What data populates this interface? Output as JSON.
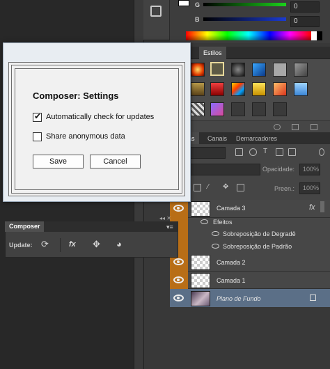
{
  "color_panel": {
    "g_label": "G",
    "b_label": "B",
    "g_value": "0",
    "b_value": "0"
  },
  "styles_panel": {
    "tabs": [
      "s",
      "Estilos"
    ]
  },
  "layers_panel": {
    "tabs": [
      "adas",
      "Canais",
      "Demarcadores"
    ],
    "kind_select": "po",
    "blend_mode": "al",
    "opacity_label": "Opacidade:",
    "opacity_value": "100%",
    "fill_label": "Preen.:",
    "fill_value": "100%",
    "layers": [
      {
        "name": "Camada 3",
        "fx": "fx"
      },
      {
        "name": "Camada 2"
      },
      {
        "name": "Camada 1"
      },
      {
        "name": "Plano de Fundo"
      }
    ],
    "effects_label": "Efeitos",
    "effects": [
      "Sobreposição de Degradê",
      "Sobreposição de Padrão"
    ]
  },
  "composer_panel": {
    "tab": "Composer",
    "update_label": "Update:",
    "fx_label": "fx",
    "close_glyph": "◂◂ ✕"
  },
  "dialog": {
    "title": "Composer: Settings",
    "options": [
      {
        "label": "Automatically check for updates",
        "checked": true
      },
      {
        "label": "Share anonymous data",
        "checked": false
      }
    ],
    "save_label": "Save",
    "cancel_label": "Cancel"
  }
}
